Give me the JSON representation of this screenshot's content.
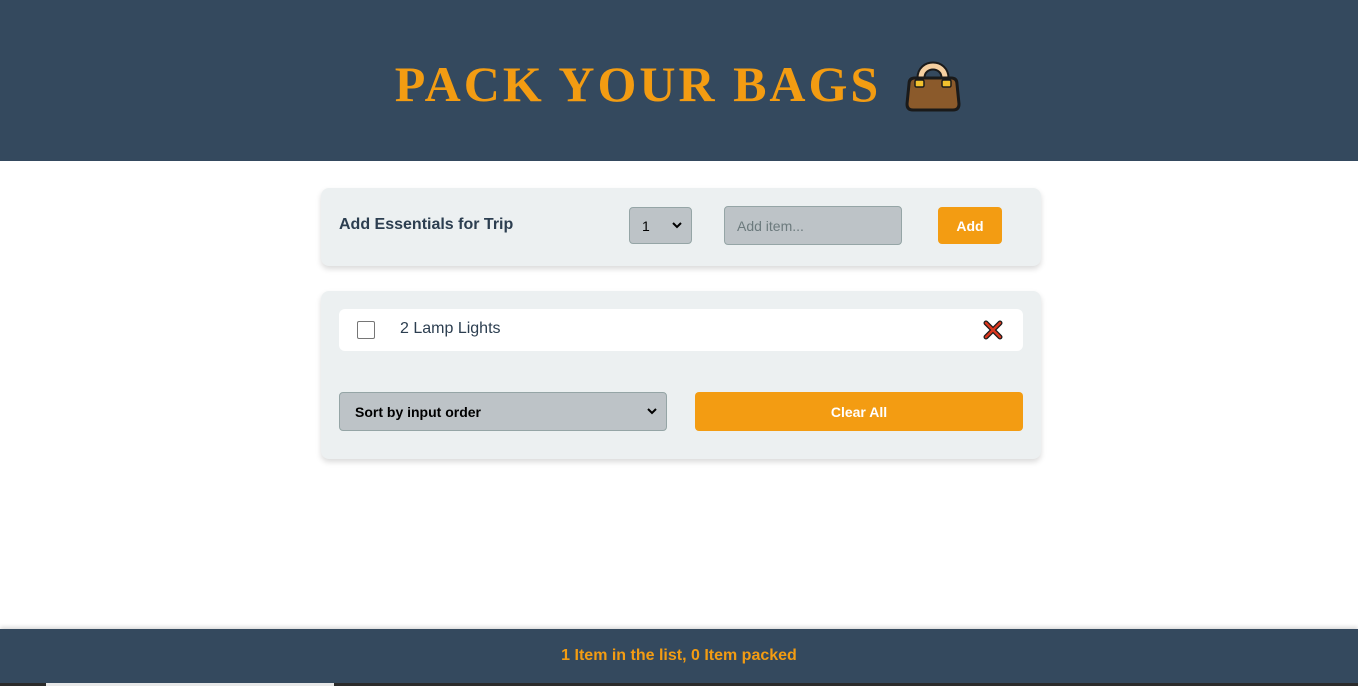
{
  "header": {
    "title": "PACK YOUR BAGS",
    "icon": "handbag-icon"
  },
  "form": {
    "label": "Add Essentials for Trip",
    "quantity_value": "1",
    "item_placeholder": "Add item...",
    "add_label": "Add"
  },
  "list": {
    "items": [
      {
        "quantity": 2,
        "text": "2 Lamp Lights",
        "packed": false
      }
    ]
  },
  "actions": {
    "sort_selected": "Sort by input order",
    "clear_label": "Clear All"
  },
  "footer": {
    "stats": "1 Item in the list, 0 Item packed"
  },
  "colors": {
    "header_bg": "#34495e",
    "accent": "#f39c12",
    "card_bg": "#ecf0f1",
    "input_bg": "#bdc3c7"
  }
}
